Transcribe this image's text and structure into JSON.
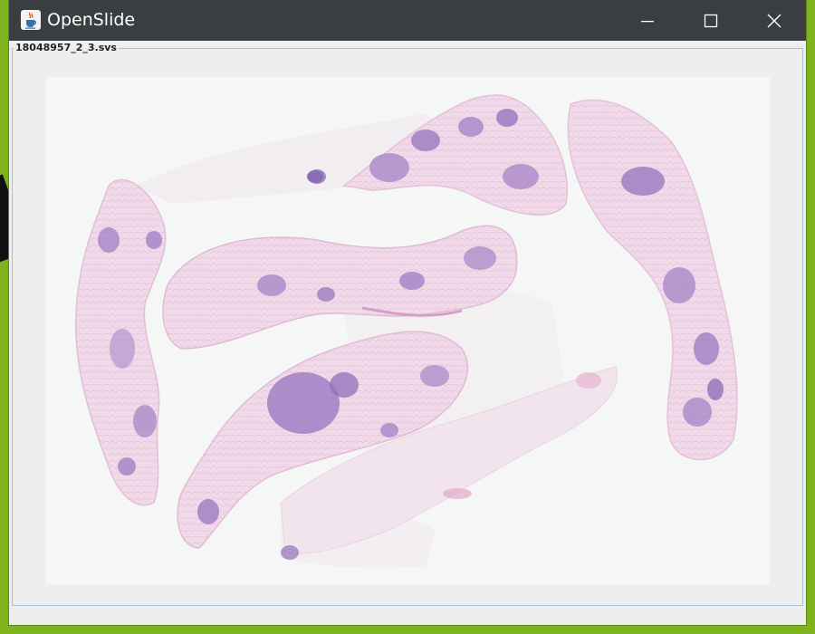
{
  "window": {
    "title": "OpenSlide",
    "icon": "java-cup-icon",
    "controls": {
      "minimize_icon": "minimize-icon",
      "maximize_icon": "maximize-icon",
      "close_icon": "close-icon"
    }
  },
  "panel": {
    "file_name": "18048957_2_3.svs"
  },
  "colors": {
    "titlebar": "#3b3e40",
    "desktop": "#7fb31e",
    "panel_border": "#a9c0db",
    "tissue_pink": "#ebc6df",
    "tissue_purple": "#9b7cc4"
  }
}
